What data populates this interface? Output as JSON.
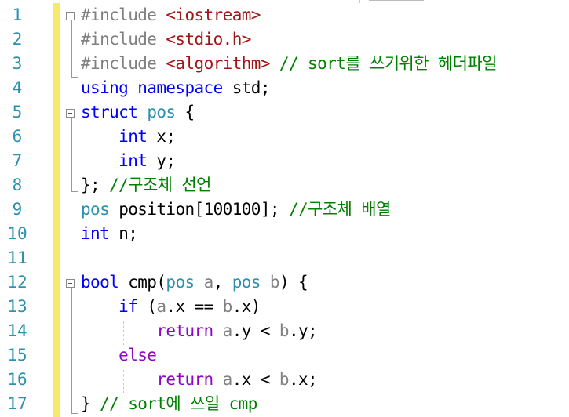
{
  "editor": {
    "line_numbers": [
      "1",
      "2",
      "3",
      "4",
      "5",
      "6",
      "7",
      "8",
      "9",
      "10",
      "11",
      "12",
      "13",
      "14",
      "15",
      "16",
      "17"
    ],
    "lines": [
      [
        {
          "t": "#include ",
          "c": "pp"
        },
        {
          "t": "<iostream>",
          "c": "str"
        }
      ],
      [
        {
          "t": "#include ",
          "c": "pp"
        },
        {
          "t": "<stdio.h>",
          "c": "str"
        }
      ],
      [
        {
          "t": "#include ",
          "c": "pp"
        },
        {
          "t": "<algorithm>",
          "c": "str"
        },
        {
          "t": " // sort를 쓰기위한 헤더파일",
          "c": "cm"
        }
      ],
      [
        {
          "t": "using namespace ",
          "c": "kw"
        },
        {
          "t": "std;",
          "c": ""
        }
      ],
      [
        {
          "t": "struct ",
          "c": "kw"
        },
        {
          "t": "pos",
          "c": "type"
        },
        {
          "t": " {",
          "c": ""
        }
      ],
      [
        {
          "t": "    int ",
          "c": "kw"
        },
        {
          "t": "x;",
          "c": ""
        }
      ],
      [
        {
          "t": "    int ",
          "c": "kw"
        },
        {
          "t": "y;",
          "c": ""
        }
      ],
      [
        {
          "t": "}; ",
          "c": ""
        },
        {
          "t": "//구조체 선언",
          "c": "cm"
        }
      ],
      [
        {
          "t": "pos ",
          "c": "type"
        },
        {
          "t": "position[100100]; ",
          "c": ""
        },
        {
          "t": "//구조체 배열",
          "c": "cm"
        }
      ],
      [
        {
          "t": "int ",
          "c": "kw"
        },
        {
          "t": "n;",
          "c": ""
        }
      ],
      [],
      [
        {
          "t": "bool ",
          "c": "kw"
        },
        {
          "t": "cmp(",
          "c": ""
        },
        {
          "t": "pos ",
          "c": "type"
        },
        {
          "t": "a",
          "c": "par"
        },
        {
          "t": ", ",
          "c": ""
        },
        {
          "t": "pos ",
          "c": "type"
        },
        {
          "t": "b",
          "c": "par"
        },
        {
          "t": ") {",
          "c": ""
        }
      ],
      [
        {
          "t": "    if ",
          "c": "kw"
        },
        {
          "t": "(",
          "c": ""
        },
        {
          "t": "a",
          "c": "par"
        },
        {
          "t": ".x == ",
          "c": ""
        },
        {
          "t": "b",
          "c": "par"
        },
        {
          "t": ".x)",
          "c": ""
        }
      ],
      [
        {
          "t": "        return ",
          "c": "kw2"
        },
        {
          "t": "a",
          "c": "par"
        },
        {
          "t": ".y < ",
          "c": ""
        },
        {
          "t": "b",
          "c": "par"
        },
        {
          "t": ".y;",
          "c": ""
        }
      ],
      [
        {
          "t": "    else",
          "c": "kw2"
        }
      ],
      [
        {
          "t": "        return ",
          "c": "kw2"
        },
        {
          "t": "a",
          "c": "par"
        },
        {
          "t": ".x < ",
          "c": ""
        },
        {
          "t": "b",
          "c": "par"
        },
        {
          "t": ".x;",
          "c": ""
        }
      ],
      [
        {
          "t": "} ",
          "c": ""
        },
        {
          "t": "// sort에 쓰일 cmp",
          "c": "cm"
        }
      ]
    ]
  }
}
